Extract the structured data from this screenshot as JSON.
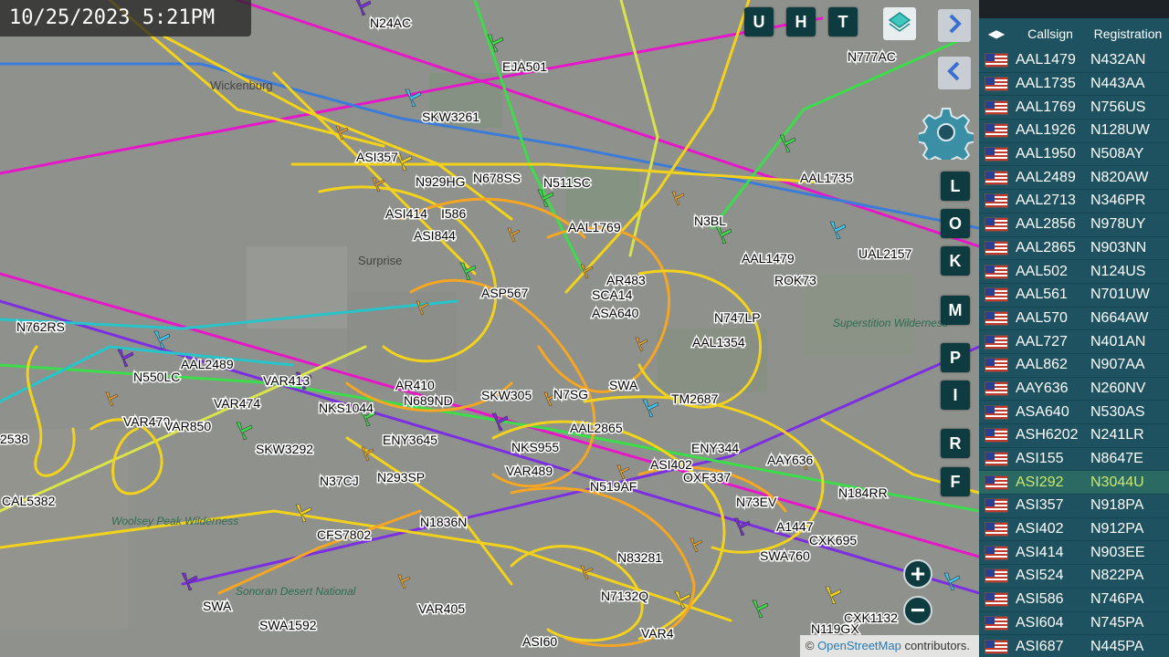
{
  "timestamp": "10/25/2023 5:21PM",
  "buttons": {
    "u": "U",
    "h": "H",
    "t": "T",
    "side": [
      "L",
      "O",
      "K",
      "M",
      "P",
      "I",
      "R",
      "F"
    ],
    "zoom_in": "+",
    "zoom_out": "−"
  },
  "attribution": {
    "prefix": "© ",
    "link": "OpenStreetMap",
    "suffix": " contributors."
  },
  "map_labels": {
    "places": [
      "Surprise",
      "Wickenburg"
    ],
    "terrain": [
      "Superstition Wilderness",
      "Woolsey Peak Wilderness",
      "Sonoran Desert National"
    ],
    "aircraft": [
      "N24AC",
      "EJA501",
      "N777AC",
      "SKW3261",
      "ASI357",
      "N929HG",
      "N678SS",
      "N511SC",
      "AAL1735",
      "ASI414",
      "I586",
      "ASI844",
      "AAL1769",
      "N3BL",
      "UAL2157",
      "AAL1479",
      "ROK73",
      "N762RS",
      "ASP567",
      "AR483",
      "SCA14",
      "ASA640",
      "N747LP",
      "AAL1354",
      "N550LC",
      "AAL2489",
      "VAR413",
      "VAR474",
      "NKS1044",
      "AR410",
      "N689ND",
      "SKW305",
      "N7SG",
      "SWA",
      "TM2687",
      "VAR470",
      "VAR850",
      "AAL2865",
      "ENY3645",
      "SKW3292",
      "NKS955",
      "ENY344",
      "AAY636",
      "N37CJ",
      "N293SP",
      "VAR489",
      "N519AF",
      "ASI402",
      "OXF337",
      "N184RR",
      "CAL5382",
      "N73EV",
      "CFS7802",
      "N1836N",
      "A1447",
      "CXK695",
      "SWA760",
      "N83281",
      "VAR405",
      "N7132Q",
      "SWA",
      "SWA1592",
      "VAR4",
      "ASI60",
      "CXK1132",
      "N119GX",
      "2538"
    ]
  },
  "panel": {
    "columns": {
      "callsign": "Callsign",
      "registration": "Registration"
    },
    "rows": [
      {
        "callsign": "AAL1479",
        "registration": "N432AN"
      },
      {
        "callsign": "AAL1735",
        "registration": "N443AA"
      },
      {
        "callsign": "AAL1769",
        "registration": "N756US"
      },
      {
        "callsign": "AAL1926",
        "registration": "N128UW"
      },
      {
        "callsign": "AAL1950",
        "registration": "N508AY"
      },
      {
        "callsign": "AAL2489",
        "registration": "N820AW"
      },
      {
        "callsign": "AAL2713",
        "registration": "N346PR"
      },
      {
        "callsign": "AAL2856",
        "registration": "N978UY"
      },
      {
        "callsign": "AAL2865",
        "registration": "N903NN"
      },
      {
        "callsign": "AAL502",
        "registration": "N124US"
      },
      {
        "callsign": "AAL561",
        "registration": "N701UW"
      },
      {
        "callsign": "AAL570",
        "registration": "N664AW"
      },
      {
        "callsign": "AAL727",
        "registration": "N401AN"
      },
      {
        "callsign": "AAL862",
        "registration": "N907AA"
      },
      {
        "callsign": "AAY636",
        "registration": "N260NV"
      },
      {
        "callsign": "ASA640",
        "registration": "N530AS"
      },
      {
        "callsign": "ASH6202",
        "registration": "N241LR"
      },
      {
        "callsign": "ASI155",
        "registration": "N8647E"
      },
      {
        "callsign": "ASI292",
        "registration": "N3044U",
        "selected": true
      },
      {
        "callsign": "ASI357",
        "registration": "N918PA"
      },
      {
        "callsign": "ASI402",
        "registration": "N912PA"
      },
      {
        "callsign": "ASI414",
        "registration": "N903EE"
      },
      {
        "callsign": "ASI524",
        "registration": "N822PA"
      },
      {
        "callsign": "ASI586",
        "registration": "N746PA"
      },
      {
        "callsign": "ASI604",
        "registration": "N745PA"
      },
      {
        "callsign": "ASI687",
        "registration": "N445PA"
      }
    ]
  },
  "colors": {
    "map_bg": "#8f918c",
    "panel_bg": "#1e5260",
    "button_bg": "#0d3b40",
    "track_orange": "#f5a623",
    "track_yellow": "#f2d21b",
    "track_magenta": "#e617c8",
    "track_green": "#3ddc4a",
    "track_blue": "#3b7bd9",
    "track_purple": "#7b2fe0"
  }
}
